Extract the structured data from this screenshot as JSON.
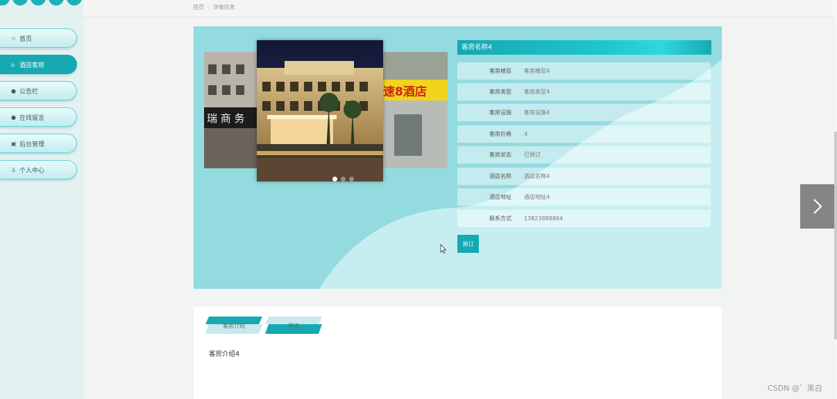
{
  "sidebar": {
    "items": [
      {
        "label": "首页",
        "icon": "star-icon",
        "active": false
      },
      {
        "label": "酒店客房",
        "icon": "home-icon",
        "active": true
      },
      {
        "label": "公告栏",
        "icon": "info-icon",
        "active": false
      },
      {
        "label": "在线留言",
        "icon": "help-icon",
        "active": false
      },
      {
        "label": "后台管理",
        "icon": "dashboard-icon",
        "active": false
      },
      {
        "label": "个人中心",
        "icon": "user-icon",
        "active": false
      }
    ]
  },
  "breadcrumb": {
    "home": "首页",
    "separator": "⁝",
    "current": "详情信息"
  },
  "detail": {
    "title": "客房名称4",
    "fields": [
      {
        "label": "客房楼层",
        "value": "客房楼层4"
      },
      {
        "label": "客房类型",
        "value": "客房类型4"
      },
      {
        "label": "客房设施",
        "value": "客房设施4"
      },
      {
        "label": "客房价格",
        "value": "4"
      },
      {
        "label": "客房状态",
        "value": "已预订"
      },
      {
        "label": "酒店名称",
        "value": "酒店名称4"
      },
      {
        "label": "酒店地址",
        "value": "酒店地址4"
      },
      {
        "label": "联系方式",
        "value": "13823888884"
      }
    ],
    "book_label": "预订"
  },
  "carousel": {
    "slides": [
      {
        "sign_text": "瑞 商 务"
      },
      {
        "sign_text": ""
      },
      {
        "sign_text": "速8酒店"
      }
    ],
    "active_index": 0,
    "dot_count": 3
  },
  "tabs": {
    "items": [
      {
        "label": "客房介绍"
      },
      {
        "label": "评论"
      }
    ],
    "content": "客房介绍4"
  },
  "watermark": "CSDN @゛黑白",
  "colors": {
    "accent": "#16a9b1",
    "panel_bg": "#94dbe0",
    "sidebar_bg": "#e3f1f1"
  }
}
